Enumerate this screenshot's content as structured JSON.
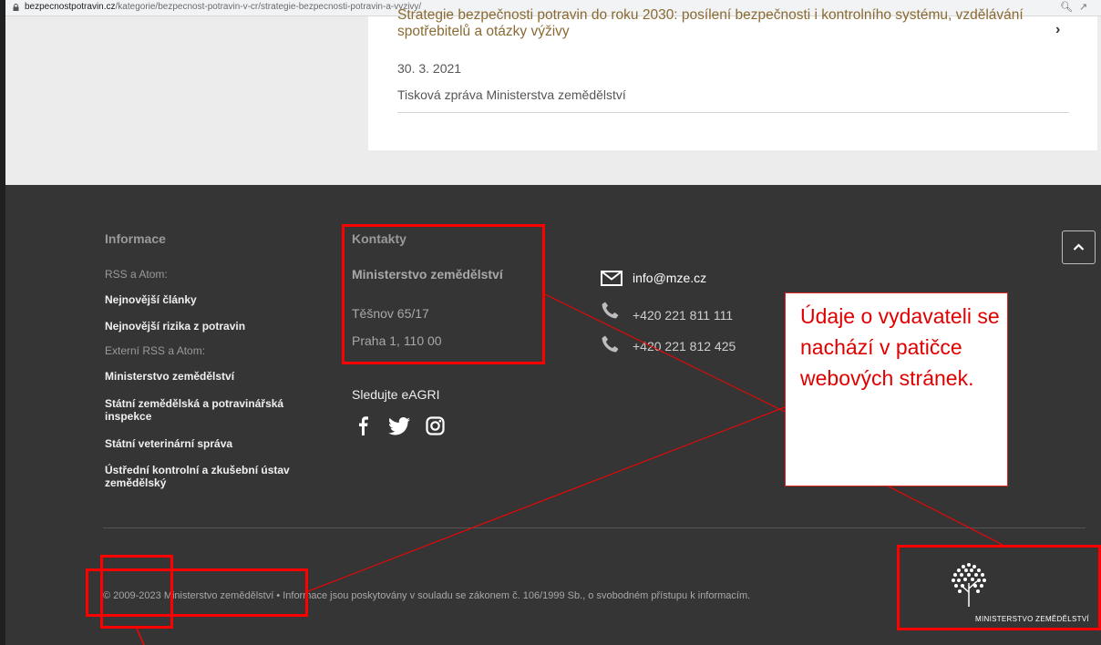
{
  "browser": {
    "url_domain": "bezpecnostpotravin.cz",
    "url_path": "/kategorie/bezpecnost-potravin-v-cr/strategie-bezpecnosti-potravin-a-vyzivy/"
  },
  "article": {
    "title": "Strategie bezpečnosti potravin do roku 2030: posílení bezpečnosti i kontrolního systému, vzdělávání spotřebitelů a otázky výživy",
    "date": "30. 3. 2021",
    "description": "Tisková zpráva Ministerstva zemědělství"
  },
  "footer": {
    "info": {
      "heading": "Informace",
      "rss_label": "RSS a Atom:",
      "latest_articles": "Nejnovější články",
      "latest_risks": "Nejnovější rizika z potravin",
      "external_rss_label": "Externí RSS a Atom:",
      "links": [
        "Ministerstvo zemědělství",
        "Státní zemědělská a potravinářská inspekce",
        "Státní veterinární správa",
        "Ústřední kontrolní a zkušební ústav zemědělský"
      ]
    },
    "contacts": {
      "heading": "Kontakty",
      "org": "Ministerstvo zemědělství",
      "street": "Těšnov 65/17",
      "city": "Praha 1, 110 00",
      "email": "info@mze.cz",
      "phones": [
        "+420 221 811 111",
        "+420 221 812 425"
      ]
    },
    "social": {
      "heading": "Sledujte eAGRI",
      "icons": [
        "facebook-icon",
        "twitter-icon",
        "instagram-icon"
      ]
    },
    "copyright": "© 2009-2023 Ministerstvo zemědělství • Informace jsou poskytovány v souladu se zákonem č. 106/1999 Sb., o svobodném přístupu k informacím.",
    "logo_text": "MINISTERSTVO ZEMĚDĚLSTVÍ"
  },
  "annotation": {
    "callout_text": "Údaje o vydavateli se nachází v patičce webových stránek.",
    "color": "#ff0000"
  },
  "colors": {
    "footer_bg": "#353535",
    "article_link": "#8a6a32"
  }
}
